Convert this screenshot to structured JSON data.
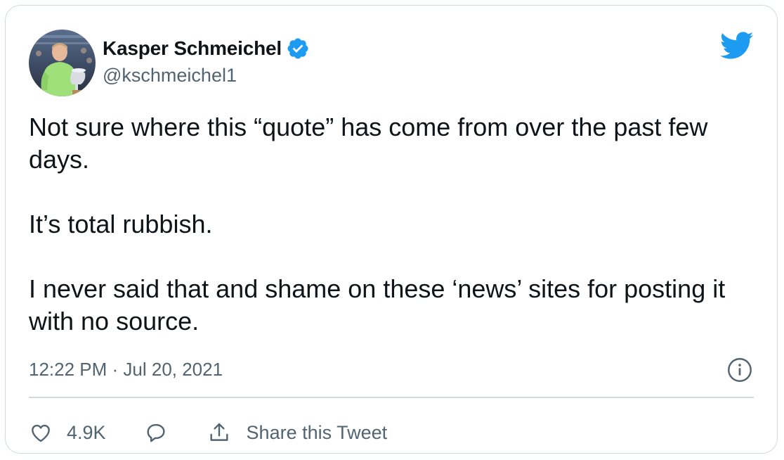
{
  "author": {
    "display_name": "Kasper Schmeichel",
    "handle": "@kschmeichel1",
    "verified": true
  },
  "tweet": {
    "paragraphs": [
      "Not sure where this “quote” has come from over the past few days.",
      "It’s total rubbish.",
      "I never said that and shame on these ‘news’ sites for posting it with no source."
    ],
    "timestamp": "12:22 PM · Jul 20, 2021"
  },
  "actions": {
    "like_count": "4.9K",
    "share_label": "Share this Tweet"
  },
  "icons": {
    "brand": "twitter-bird-icon",
    "verified": "verified-badge-icon",
    "info": "info-icon",
    "like": "heart-icon",
    "reply": "reply-bubble-icon",
    "share": "share-icon"
  },
  "colors": {
    "brand_blue": "#1d9bf0",
    "text_primary": "#0f1419",
    "text_secondary": "#536471",
    "border": "#cfd9de"
  }
}
